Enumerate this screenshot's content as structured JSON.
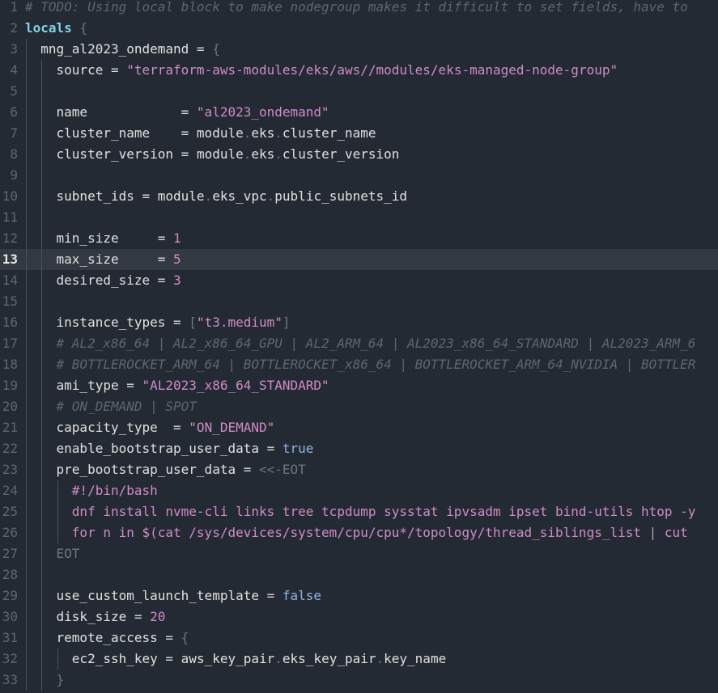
{
  "editor": {
    "current_line": 13,
    "lines": [
      {
        "n": "1",
        "guides": [],
        "tokens": [
          [
            "comment",
            "# TODO: Using local block to make nodegroup makes it difficult to set fields, have to"
          ]
        ]
      },
      {
        "n": "2",
        "guides": [],
        "tokens": [
          [
            "kw",
            "locals"
          ],
          [
            "op",
            " "
          ],
          [
            "dim",
            "{"
          ]
        ]
      },
      {
        "n": "3",
        "guides": [
          1
        ],
        "tokens": [
          [
            "op",
            "  "
          ],
          [
            "ident",
            "mng_al2023_ondemand"
          ],
          [
            "op",
            " = "
          ],
          [
            "dim",
            "{"
          ]
        ]
      },
      {
        "n": "4",
        "guides": [
          1,
          2
        ],
        "tokens": [
          [
            "op",
            "    "
          ],
          [
            "ident",
            "source"
          ],
          [
            "op",
            " = "
          ],
          [
            "string",
            "\"terraform-aws-modules/eks/aws//modules/eks-managed-node-group\""
          ]
        ]
      },
      {
        "n": "5",
        "guides": [
          1,
          2
        ],
        "tokens": []
      },
      {
        "n": "6",
        "guides": [
          1,
          2
        ],
        "tokens": [
          [
            "op",
            "    "
          ],
          [
            "ident",
            "name"
          ],
          [
            "op",
            "            = "
          ],
          [
            "string",
            "\"al2023_ondemand\""
          ]
        ]
      },
      {
        "n": "7",
        "guides": [
          1,
          2
        ],
        "tokens": [
          [
            "op",
            "    "
          ],
          [
            "ident",
            "cluster_name"
          ],
          [
            "op",
            "    = "
          ],
          [
            "ident",
            "module"
          ],
          [
            "dim",
            "."
          ],
          [
            "ident",
            "eks"
          ],
          [
            "dim",
            "."
          ],
          [
            "ident",
            "cluster_name"
          ]
        ]
      },
      {
        "n": "8",
        "guides": [
          1,
          2
        ],
        "tokens": [
          [
            "op",
            "    "
          ],
          [
            "ident",
            "cluster_version"
          ],
          [
            "op",
            " = "
          ],
          [
            "ident",
            "module"
          ],
          [
            "dim",
            "."
          ],
          [
            "ident",
            "eks"
          ],
          [
            "dim",
            "."
          ],
          [
            "ident",
            "cluster_version"
          ]
        ]
      },
      {
        "n": "9",
        "guides": [
          1,
          2
        ],
        "tokens": []
      },
      {
        "n": "10",
        "guides": [
          1,
          2
        ],
        "tokens": [
          [
            "op",
            "    "
          ],
          [
            "ident",
            "subnet_ids"
          ],
          [
            "op",
            " = "
          ],
          [
            "ident",
            "module"
          ],
          [
            "dim",
            "."
          ],
          [
            "ident",
            "eks_vpc"
          ],
          [
            "dim",
            "."
          ],
          [
            "ident",
            "public_subnets_id"
          ]
        ]
      },
      {
        "n": "11",
        "guides": [
          1,
          2
        ],
        "tokens": []
      },
      {
        "n": "12",
        "guides": [
          1,
          2
        ],
        "tokens": [
          [
            "op",
            "    "
          ],
          [
            "ident",
            "min_size"
          ],
          [
            "op",
            "     = "
          ],
          [
            "number",
            "1"
          ]
        ]
      },
      {
        "n": "13",
        "guides": [
          1,
          2
        ],
        "tokens": [
          [
            "op",
            "    "
          ],
          [
            "ident",
            "max_size"
          ],
          [
            "op",
            "     = "
          ],
          [
            "number",
            "5"
          ]
        ]
      },
      {
        "n": "14",
        "guides": [
          1,
          2
        ],
        "tokens": [
          [
            "op",
            "    "
          ],
          [
            "ident",
            "desired_size"
          ],
          [
            "op",
            " = "
          ],
          [
            "number",
            "3"
          ]
        ]
      },
      {
        "n": "15",
        "guides": [
          1,
          2
        ],
        "tokens": []
      },
      {
        "n": "16",
        "guides": [
          1,
          2
        ],
        "tokens": [
          [
            "op",
            "    "
          ],
          [
            "ident",
            "instance_types"
          ],
          [
            "op",
            " = "
          ],
          [
            "dim",
            "["
          ],
          [
            "string",
            "\"t3.medium\""
          ],
          [
            "dim",
            "]"
          ]
        ]
      },
      {
        "n": "17",
        "guides": [
          1,
          2
        ],
        "tokens": [
          [
            "op",
            "    "
          ],
          [
            "comment",
            "# AL2_x86_64 | AL2_x86_64_GPU | AL2_ARM_64 | AL2023_x86_64_STANDARD | AL2023_ARM_6"
          ]
        ]
      },
      {
        "n": "18",
        "guides": [
          1,
          2
        ],
        "tokens": [
          [
            "op",
            "    "
          ],
          [
            "comment",
            "# BOTTLEROCKET_ARM_64 | BOTTLEROCKET_x86_64 | BOTTLEROCKET_ARM_64_NVIDIA | BOTTLER"
          ]
        ]
      },
      {
        "n": "19",
        "guides": [
          1,
          2
        ],
        "tokens": [
          [
            "op",
            "    "
          ],
          [
            "ident",
            "ami_type"
          ],
          [
            "op",
            " = "
          ],
          [
            "string",
            "\"AL2023_x86_64_STANDARD\""
          ]
        ]
      },
      {
        "n": "20",
        "guides": [
          1,
          2
        ],
        "tokens": [
          [
            "op",
            "    "
          ],
          [
            "comment",
            "# ON_DEMAND | SPOT"
          ]
        ]
      },
      {
        "n": "21",
        "guides": [
          1,
          2
        ],
        "tokens": [
          [
            "op",
            "    "
          ],
          [
            "ident",
            "capacity_type"
          ],
          [
            "op",
            "  = "
          ],
          [
            "string",
            "\"ON_DEMAND\""
          ]
        ]
      },
      {
        "n": "22",
        "guides": [
          1,
          2
        ],
        "tokens": [
          [
            "op",
            "    "
          ],
          [
            "ident",
            "enable_bootstrap_user_data"
          ],
          [
            "op",
            " = "
          ],
          [
            "bool",
            "true"
          ]
        ]
      },
      {
        "n": "23",
        "guides": [
          1,
          2
        ],
        "tokens": [
          [
            "op",
            "    "
          ],
          [
            "ident",
            "pre_bootstrap_user_data"
          ],
          [
            "op",
            " = "
          ],
          [
            "dim",
            "<<-EOT"
          ]
        ]
      },
      {
        "n": "24",
        "guides": [
          1,
          2,
          3
        ],
        "tokens": [
          [
            "op",
            "      "
          ],
          [
            "heredoc",
            "#!/bin/bash"
          ]
        ]
      },
      {
        "n": "25",
        "guides": [
          1,
          2,
          3
        ],
        "tokens": [
          [
            "op",
            "      "
          ],
          [
            "heredoc",
            "dnf install nvme-cli links tree tcpdump sysstat ipvsadm ipset bind-utils htop -y"
          ]
        ]
      },
      {
        "n": "26",
        "guides": [
          1,
          2,
          3
        ],
        "tokens": [
          [
            "op",
            "      "
          ],
          [
            "heredoc",
            "for n in $(cat /sys/devices/system/cpu/cpu*/topology/thread_siblings_list | cut"
          ]
        ]
      },
      {
        "n": "27",
        "guides": [
          1,
          2
        ],
        "tokens": [
          [
            "op",
            "    "
          ],
          [
            "dim",
            "EOT"
          ]
        ]
      },
      {
        "n": "28",
        "guides": [
          1,
          2
        ],
        "tokens": []
      },
      {
        "n": "29",
        "guides": [
          1,
          2
        ],
        "tokens": [
          [
            "op",
            "    "
          ],
          [
            "ident",
            "use_custom_launch_template"
          ],
          [
            "op",
            " = "
          ],
          [
            "bool",
            "false"
          ]
        ]
      },
      {
        "n": "30",
        "guides": [
          1,
          2
        ],
        "tokens": [
          [
            "op",
            "    "
          ],
          [
            "ident",
            "disk_size"
          ],
          [
            "op",
            " = "
          ],
          [
            "number",
            "20"
          ]
        ]
      },
      {
        "n": "31",
        "guides": [
          1,
          2
        ],
        "tokens": [
          [
            "op",
            "    "
          ],
          [
            "ident",
            "remote_access"
          ],
          [
            "op",
            " = "
          ],
          [
            "dim",
            "{"
          ]
        ]
      },
      {
        "n": "32",
        "guides": [
          1,
          2,
          3
        ],
        "tokens": [
          [
            "op",
            "      "
          ],
          [
            "ident",
            "ec2_ssh_key"
          ],
          [
            "op",
            " = "
          ],
          [
            "ident",
            "aws_key_pair"
          ],
          [
            "dim",
            "."
          ],
          [
            "ident",
            "eks_key_pair"
          ],
          [
            "dim",
            "."
          ],
          [
            "ident",
            "key_name"
          ]
        ]
      },
      {
        "n": "33",
        "guides": [
          1,
          2
        ],
        "tokens": [
          [
            "op",
            "    "
          ],
          [
            "dim",
            "}"
          ]
        ]
      }
    ]
  }
}
